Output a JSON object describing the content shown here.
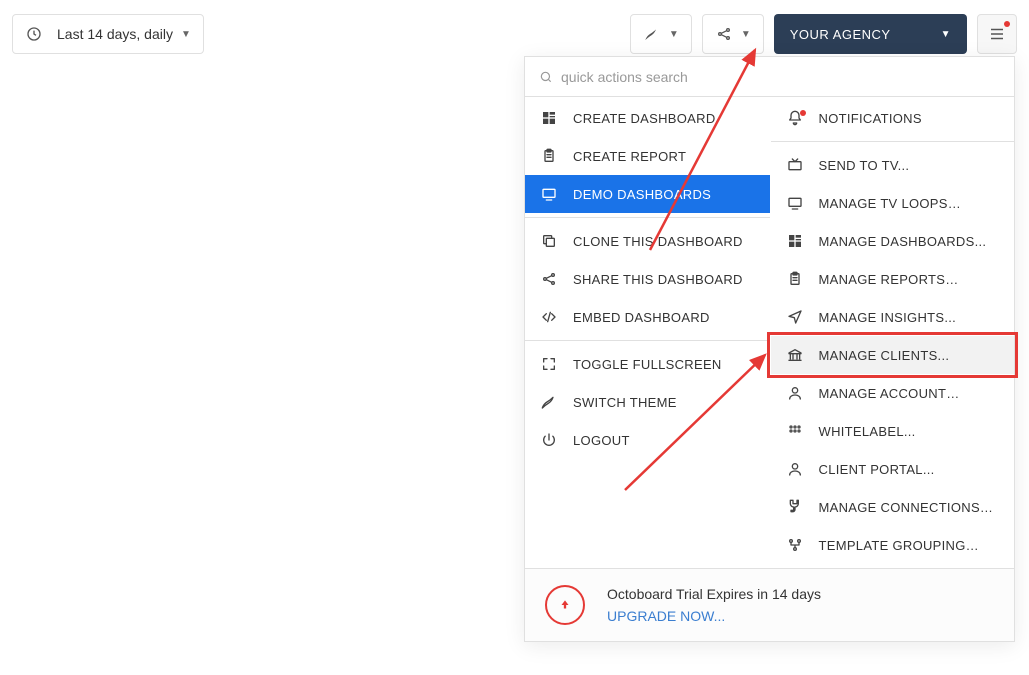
{
  "toolbar": {
    "date_range_label": "Last 14 days, daily",
    "agency_label": "YOUR AGENCY"
  },
  "search": {
    "placeholder": "quick actions search"
  },
  "left_menu": [
    {
      "icon": "dashboard-icon",
      "label": "CREATE DASHBOARD"
    },
    {
      "icon": "clipboard-icon",
      "label": "CREATE REPORT"
    },
    {
      "icon": "screen-icon",
      "label": "DEMO DASHBOARDS",
      "selected": true
    },
    {
      "separator": true
    },
    {
      "icon": "copy-icon",
      "label": "CLONE THIS DASHBOARD"
    },
    {
      "icon": "share-icon",
      "label": "SHARE THIS DASHBOARD"
    },
    {
      "icon": "code-icon",
      "label": "EMBED DASHBOARD"
    },
    {
      "separator": true
    },
    {
      "icon": "fullscreen-icon",
      "label": "TOGGLE FULLSCREEN"
    },
    {
      "icon": "theme-icon",
      "label": "SWITCH THEME"
    },
    {
      "icon": "power-icon",
      "label": "LOGOUT"
    }
  ],
  "right_menu": [
    {
      "icon": "bell-icon",
      "label": "NOTIFICATIONS",
      "has_dot": true
    },
    {
      "separator": true
    },
    {
      "icon": "tv-icon",
      "label": "SEND TO TV..."
    },
    {
      "icon": "monitor-icon",
      "label": "MANAGE TV LOOPS…"
    },
    {
      "icon": "dashboard-icon",
      "label": "MANAGE DASHBOARDS..."
    },
    {
      "icon": "clipboard-icon",
      "label": "MANAGE REPORTS…"
    },
    {
      "icon": "send-icon",
      "label": "MANAGE INSIGHTS..."
    },
    {
      "icon": "bank-icon",
      "label": "MANAGE CLIENTS...",
      "highlighted": true
    },
    {
      "icon": "account-icon",
      "label": "MANAGE ACCOUNT…"
    },
    {
      "icon": "grid-icon",
      "label": "WHITELABEL..."
    },
    {
      "icon": "account-icon",
      "label": "CLIENT PORTAL..."
    },
    {
      "icon": "plug-icon",
      "label": "MANAGE CONNECTIONS…"
    },
    {
      "icon": "flow-icon",
      "label": "TEMPLATE GROUPING…"
    }
  ],
  "trial": {
    "line1": "Octoboard Trial Expires in 14 days",
    "line2": "UPGRADE NOW..."
  },
  "annotations": {
    "highlight_target": "MANAGE CLIENTS...",
    "arrows": [
      {
        "from_note": "points to agency dropdown caret"
      },
      {
        "from_note": "points to manage clients item"
      }
    ]
  },
  "icons": {
    "dashboard-icon": "▦",
    "clipboard-icon": "📋",
    "screen-icon": "🖵",
    "copy-icon": "⧉",
    "share-icon": "↗",
    "code-icon": "</>",
    "fullscreen-icon": "⛶",
    "theme-icon": "◐",
    "power-icon": "⏻",
    "bell-icon": "🔔",
    "tv-icon": "📺",
    "monitor-icon": "🖵",
    "send-icon": "➤",
    "bank-icon": "🏛",
    "account-icon": "👤",
    "grid-icon": "⠿",
    "plug-icon": "🔌",
    "flow-icon": "⚭",
    "clock-icon": "🕘"
  }
}
